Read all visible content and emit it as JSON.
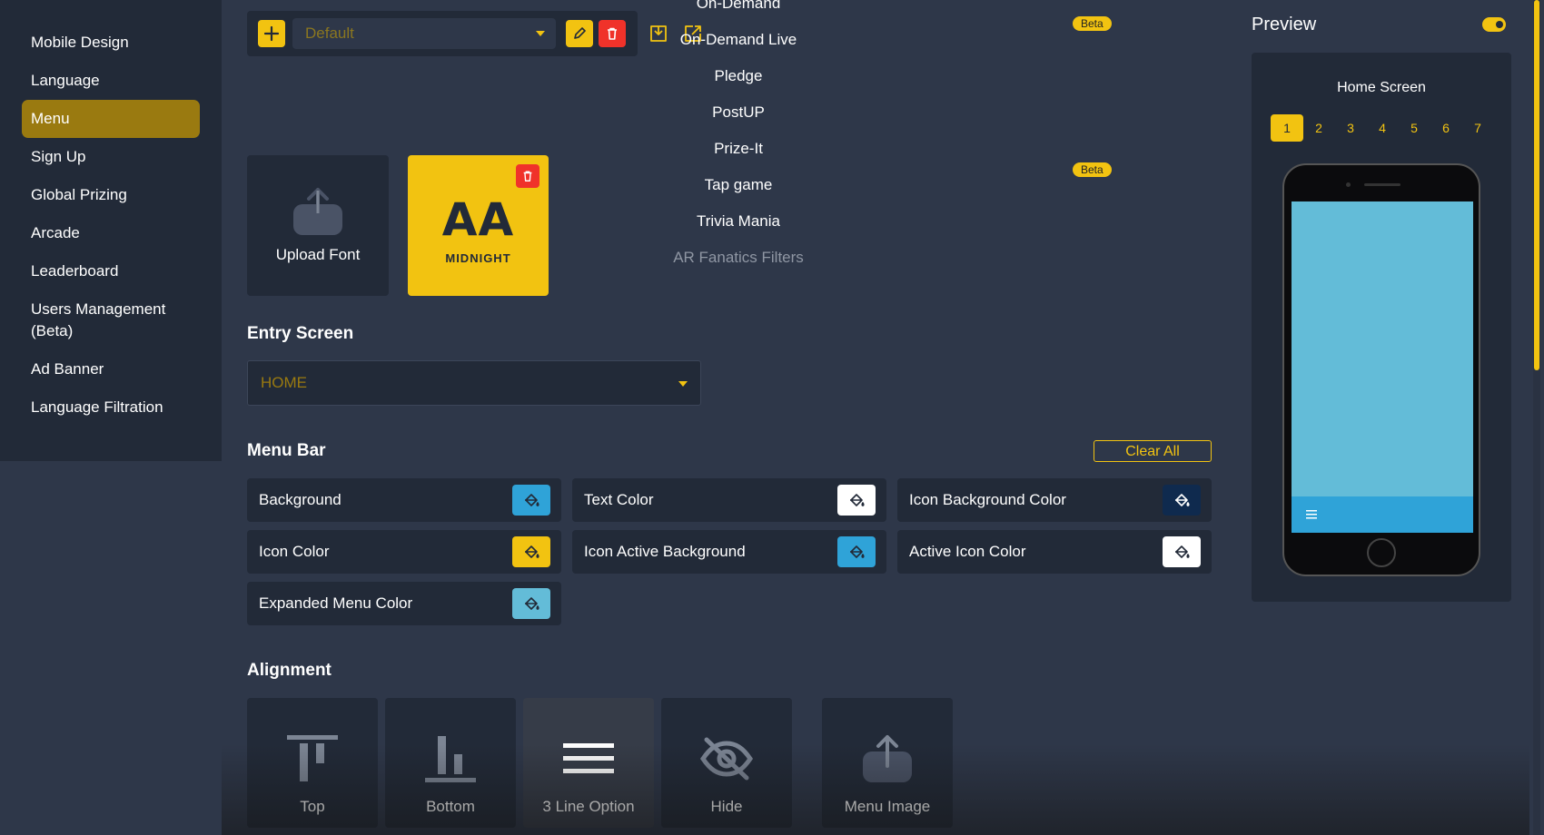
{
  "sidebar": {
    "items": [
      {
        "label": "Mobile Design"
      },
      {
        "label": "Language"
      },
      {
        "label": "Menu"
      },
      {
        "label": "Sign Up"
      },
      {
        "label": "Global Prizing"
      },
      {
        "label": "Arcade"
      },
      {
        "label": "Leaderboard"
      },
      {
        "label": "Users Management (Beta)"
      },
      {
        "label": "Ad Banner"
      },
      {
        "label": "Language Filtration"
      }
    ],
    "active_index": 2
  },
  "toolbar": {
    "preset_value": "Default",
    "icons": [
      "plus-icon",
      "edit-icon",
      "trash-icon",
      "import-icon",
      "export-icon"
    ]
  },
  "modes": {
    "items": [
      "On-Demand",
      "On-Demand Live",
      "Pledge",
      "PostUP",
      "Prize-It",
      "Tap game",
      "Trivia Mania",
      "AR Fanatics Filters"
    ],
    "beta_label_1": "Beta",
    "beta_label_2": "Beta"
  },
  "fonts": {
    "upload_label": "Upload Font",
    "font_sample": "AA",
    "font_name": "MIDNIGHT"
  },
  "entry_screen": {
    "title": "Entry Screen",
    "value": "HOME"
  },
  "menu_bar": {
    "title": "Menu Bar",
    "clear_label": "Clear All",
    "colors": [
      {
        "label": "Background",
        "color": "#2fa3d8"
      },
      {
        "label": "Text Color",
        "color": "#ffffff"
      },
      {
        "label": "Icon Background Color",
        "color": "#0f2a4e"
      },
      {
        "label": "Icon Color",
        "color": "#f2c311"
      },
      {
        "label": "Icon Active Background",
        "color": "#2fa3d8"
      },
      {
        "label": "Active Icon Color",
        "color": "#ffffff"
      },
      {
        "label": "Expanded Menu Color",
        "color": "#63bcd8"
      }
    ]
  },
  "alignment": {
    "title": "Alignment",
    "options": [
      {
        "label": "Top",
        "icon": "align-top-icon"
      },
      {
        "label": "Bottom",
        "icon": "align-bottom-icon"
      },
      {
        "label": "3 Line Option",
        "icon": "hamburger-icon"
      },
      {
        "label": "Hide",
        "icon": "eye-off-icon"
      },
      {
        "label": "Menu Image",
        "icon": "upload-icon"
      }
    ]
  },
  "preview": {
    "title": "Preview",
    "toggle_on": true,
    "screen_title": "Home Screen",
    "pages": [
      "1",
      "2",
      "3",
      "4",
      "5",
      "6",
      "7"
    ],
    "active_page": "1"
  },
  "colors": {
    "accent": "#f2c311",
    "sidebar_bg": "#222a38",
    "page_bg": "#2e3749",
    "danger": "#f0322a",
    "phone_screen": "#63bcd8",
    "phone_menu": "#2fa3d8"
  }
}
